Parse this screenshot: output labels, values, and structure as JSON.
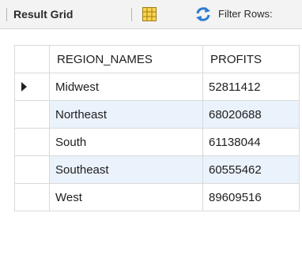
{
  "toolbar": {
    "result_grid_label": "Result Grid",
    "filter_rows_label": "Filter Rows:",
    "grid_icon": "grid-view-icon",
    "refresh_icon": "refresh-icon"
  },
  "grid": {
    "columns": [
      "REGION_NAMES",
      "PROFITS"
    ],
    "rows": [
      {
        "region": "Midwest",
        "profit": "52811412",
        "current": true
      },
      {
        "region": "Northeast",
        "profit": "68020688",
        "current": false
      },
      {
        "region": "South",
        "profit": "61138044",
        "current": false
      },
      {
        "region": "Southeast",
        "profit": "60555462",
        "current": false
      },
      {
        "region": "West",
        "profit": "89609516",
        "current": false
      }
    ],
    "current_row_icon": "current-row-arrow-icon"
  },
  "colors": {
    "alt_row": "#eaf2fb",
    "border": "#d9d9d9",
    "icon_yellow": "#f2c230",
    "refresh_blue": "#2f7bd1"
  }
}
